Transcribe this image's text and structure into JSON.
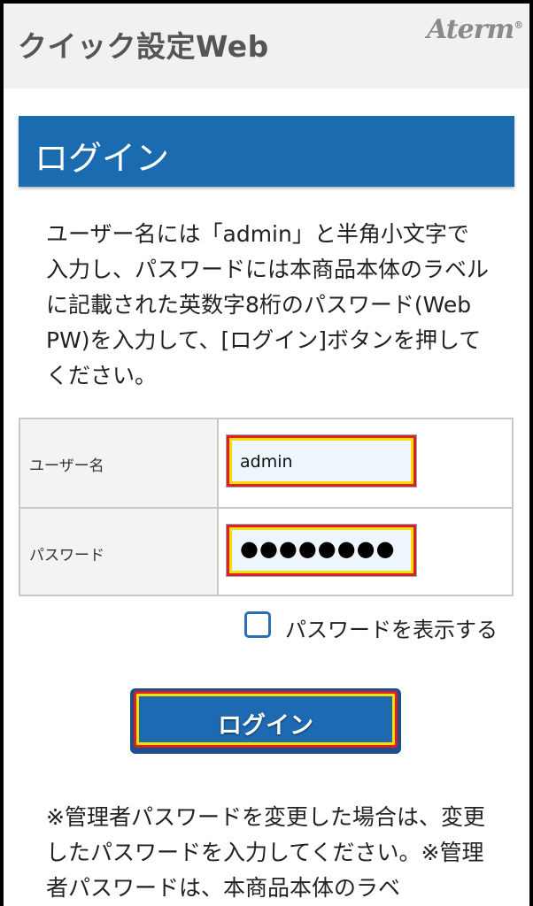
{
  "header": {
    "app_title": "クイック設定Web",
    "brand": "Aterm",
    "brand_mark": "®"
  },
  "login_panel": {
    "title": "ログイン"
  },
  "instructions": "ユーザー名には「admin」と半角小文字で入力し、パスワードには本商品本体のラベルに記載された英数字8桁のパスワード(Web PW)を入力して、[ログイン]ボタンを押してください。",
  "form": {
    "username_label": "ユーザー名",
    "username_value": "admin",
    "password_label": "パスワード",
    "password_masked": "●●●●●●●●"
  },
  "show_password": {
    "label": "パスワードを表示する",
    "checked": false
  },
  "login_button": {
    "label": "ログイン"
  },
  "notes": "※管理者パスワードを変更した場合は、変更したパスワードを入力してください。※管理者パスワードは、本商品本体のラベ",
  "colors": {
    "header_blue": "#1a6bb0",
    "button_blue": "#1d6ab3",
    "highlight_red": "#e02020",
    "highlight_yellow": "#f2e200"
  }
}
